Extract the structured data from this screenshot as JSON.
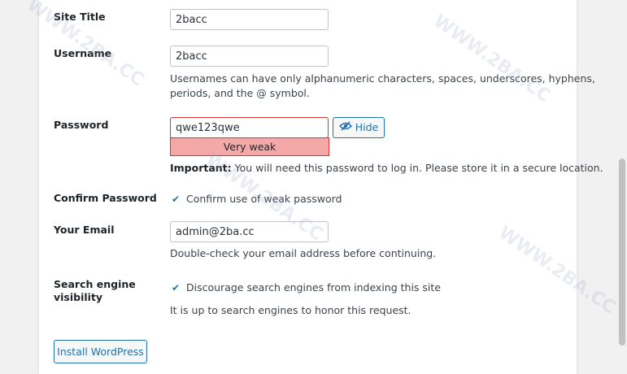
{
  "form": {
    "site_title": {
      "label": "Site Title",
      "value": "2bacc"
    },
    "username": {
      "label": "Username",
      "value": "2bacc",
      "description_line1": "Usernames can have only alphanumeric characters, spaces, underscores, hyphens,",
      "description_line2": "periods, and the @ symbol."
    },
    "password": {
      "label": "Password",
      "value": "qwe123qwe",
      "hide_label": "Hide",
      "strength": "Very weak",
      "important_prefix": "Important:",
      "important_text": " You will need this password to log in. Please store it in a secure location."
    },
    "confirm_password": {
      "label": "Confirm Password",
      "checkbox_label": "Confirm use of weak password",
      "checked": true
    },
    "email": {
      "label": "Your Email",
      "value": "admin@2ba.cc",
      "description": "Double-check your email address before continuing."
    },
    "search_engine": {
      "label_line1": "Search engine",
      "label_line2": "visibility",
      "checkbox_label": "Discourage search engines from indexing this site",
      "checked": true,
      "description": "It is up to search engines to honor this request."
    },
    "install_button": "Install WordPress"
  },
  "watermark": "WWW.2BA.CC",
  "colors": {
    "accent": "#2271b1",
    "error": "#d63638",
    "weak_bg": "#f4a8a8"
  }
}
